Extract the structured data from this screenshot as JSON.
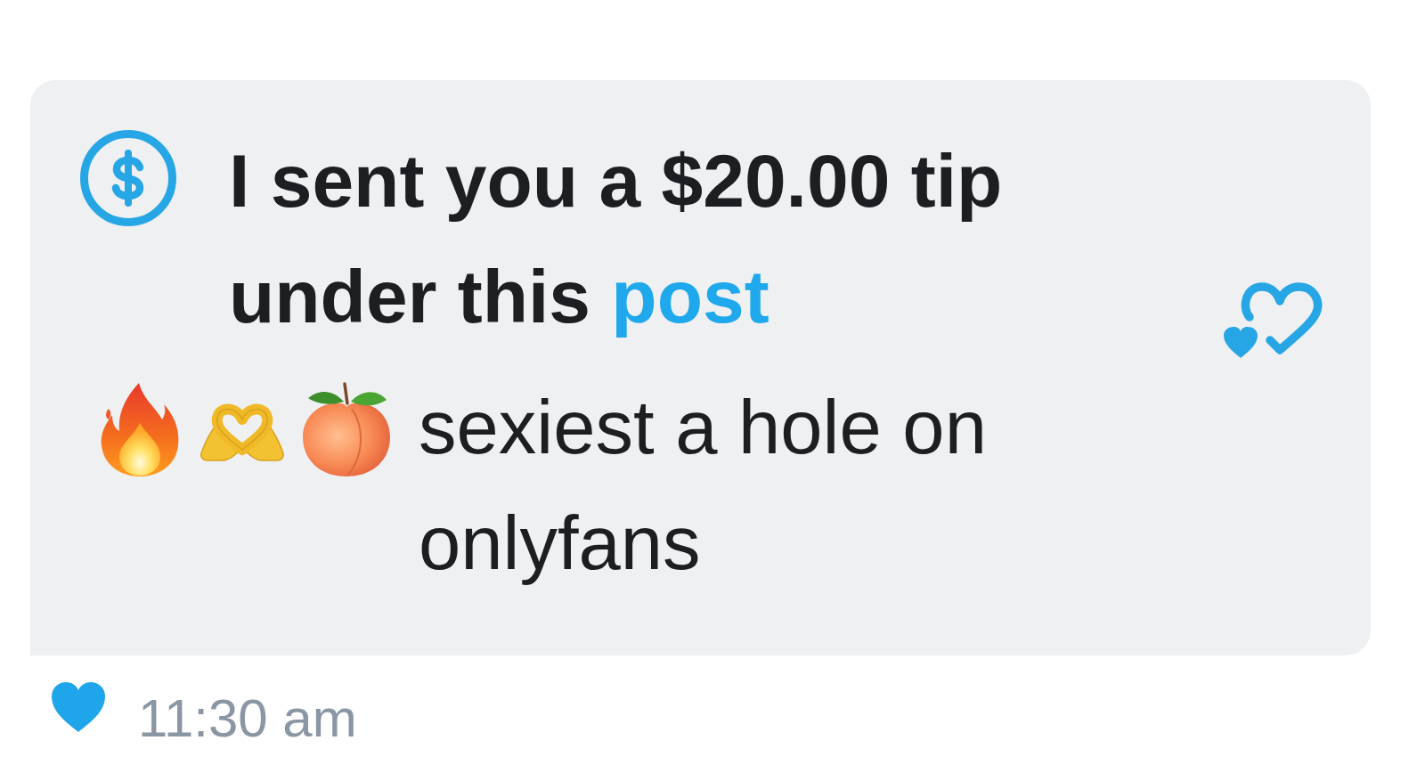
{
  "message": {
    "tip": {
      "text": "I sent you a $20.00 tip under this",
      "link": "post"
    },
    "body": "sexiest a hole on onlyfans"
  },
  "footer": {
    "liked": true,
    "time": "11:30 am"
  }
}
